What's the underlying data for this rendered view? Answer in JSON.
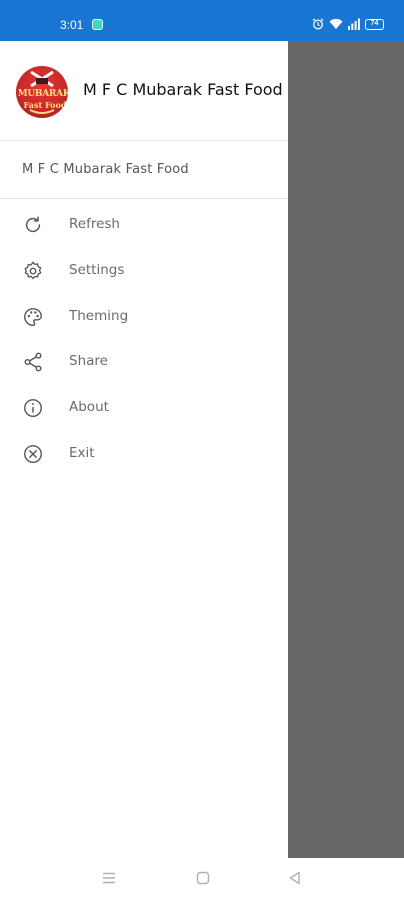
{
  "status_bar": {
    "time": "3:01",
    "battery": "74",
    "icons": [
      "app-notification-icon",
      "alarm-icon",
      "wifi-icon",
      "signal-icon",
      "battery-icon"
    ],
    "background_color": "#1976d2"
  },
  "drawer": {
    "header": {
      "logo_text_line1": "MUBARAK",
      "logo_text_line2": "Fast Food",
      "title": "M F C Mubarak Fast Food"
    },
    "subtitle": "M F C Mubarak Fast Food",
    "menu": [
      {
        "label": "Refresh",
        "icon": "refresh-icon"
      },
      {
        "label": "Settings",
        "icon": "gear-icon"
      },
      {
        "label": "Theming",
        "icon": "palette-icon"
      },
      {
        "label": "Share",
        "icon": "share-icon"
      },
      {
        "label": "About",
        "icon": "info-icon"
      },
      {
        "label": "Exit",
        "icon": "close-circle-icon"
      }
    ]
  },
  "scrim_color": "#666666",
  "navigation_bar": {
    "buttons": [
      "menu-icon",
      "home-icon",
      "back-icon"
    ]
  }
}
